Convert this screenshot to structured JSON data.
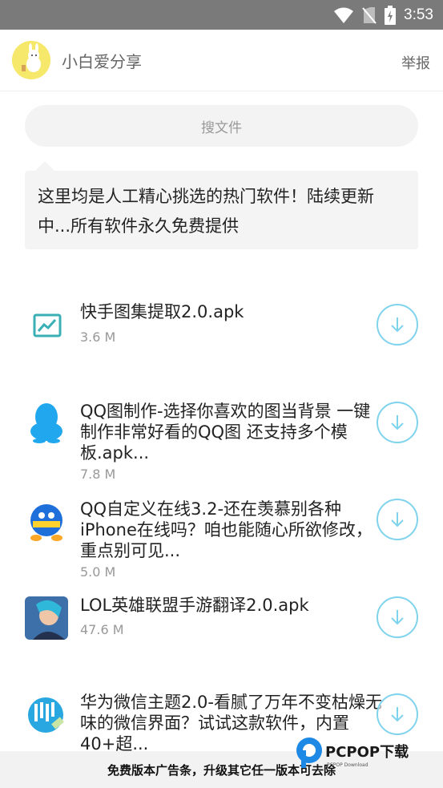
{
  "status": {
    "time": "3:53"
  },
  "header": {
    "channel_name": "小白爱分享",
    "report_label": "举报"
  },
  "search": {
    "label": "搜文件"
  },
  "notice": {
    "text": "这里均是人工精心挑选的热门软件！陆续更新中...所有软件永久免费提供"
  },
  "files": [
    {
      "name": "快手图集提取2.0.apk",
      "size": "3.6 M",
      "icon": "chart-icon"
    },
    {
      "name": "QQ图制作-选择你喜欢的图当背景 一键制作非常好看的QQ图 还支持多个模板.apk...",
      "size": "7.8 M",
      "icon": "qq-penguin-icon"
    },
    {
      "name": "QQ自定义在线3.2-还在羡慕别各种iPhone在线吗？咱也能随心所欲修改，重点别可见...",
      "size": "5.0 M",
      "icon": "qq-custom-icon"
    },
    {
      "name": "LOL英雄联盟手游翻译2.0.apk",
      "size": "47.6 M",
      "icon": "lol-hero-icon"
    },
    {
      "name": "华为微信主题2.0-看腻了万年不变枯燥无味的微信界面？试试这款软件，内置40+超...",
      "size": "",
      "icon": "theme-icon"
    }
  ],
  "ad_bar": {
    "text": "免费版本广告条，升级其它任一版本可去除"
  },
  "watermark": {
    "text": "PCPOP下载",
    "subtext": "PCPOP Download"
  },
  "colors": {
    "accent": "#7fd3ec",
    "statusbar": "#7a7a7a",
    "avatar_bg": "#f6e86b"
  }
}
